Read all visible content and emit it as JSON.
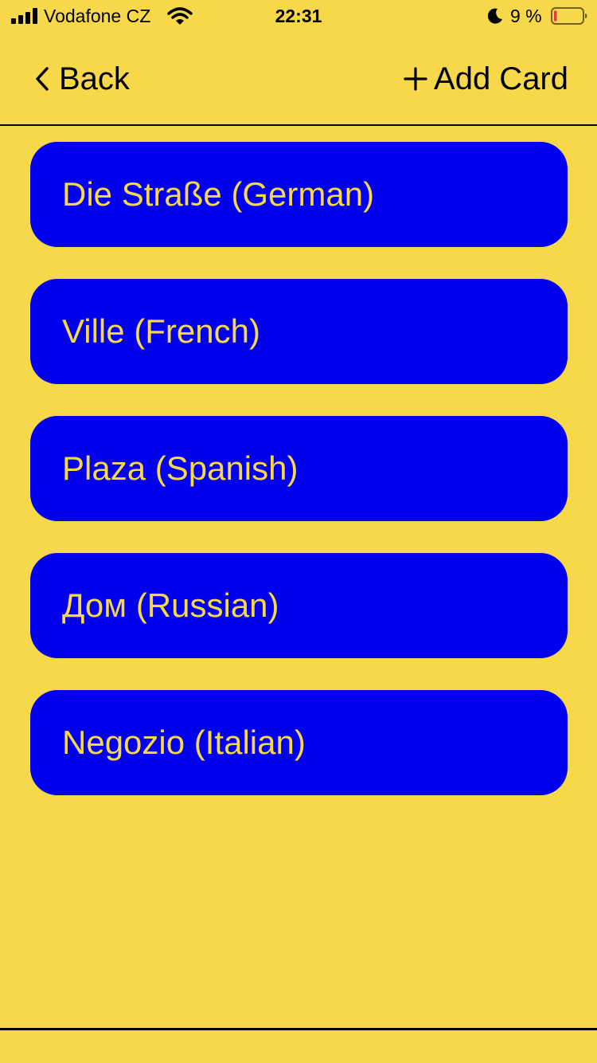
{
  "status_bar": {
    "carrier": "Vodafone CZ",
    "time": "22:31",
    "battery_text": "9 %",
    "icons": [
      "signal-icon",
      "wifi-icon",
      "moon-icon",
      "battery-icon"
    ]
  },
  "nav": {
    "back_label": "Back",
    "add_card_label": "Add Card"
  },
  "cards": [
    {
      "label": "Die Straße (German)"
    },
    {
      "label": "Ville (French)"
    },
    {
      "label": "Plaza (Spanish)"
    },
    {
      "label": "Дом (Russian)"
    },
    {
      "label": "Negozio (Italian)"
    }
  ],
  "colors": {
    "background": "#F8D84B",
    "card": "#0000EE",
    "card_text": "#F8D84B",
    "battery_low": "#E5393F"
  }
}
